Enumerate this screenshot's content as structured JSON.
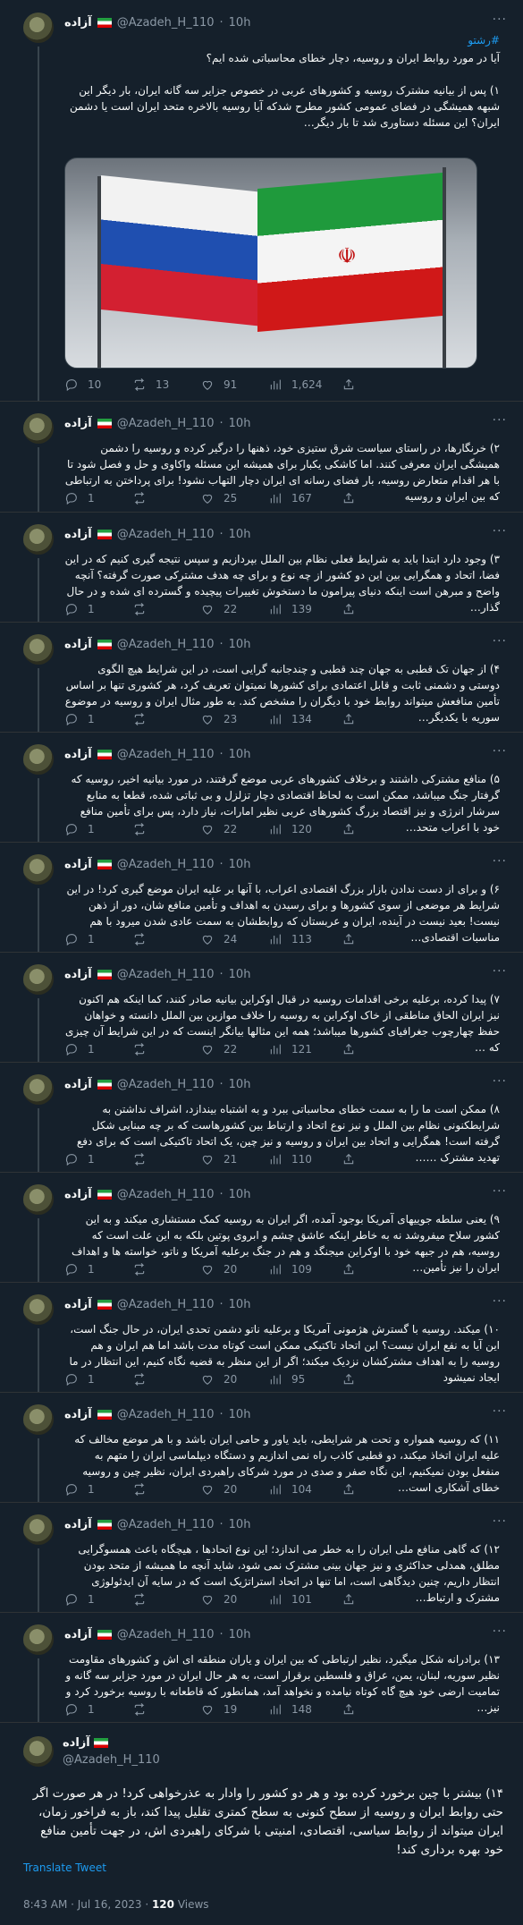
{
  "author": {
    "name": "آزاده",
    "handle": "@Azadeh_H_110",
    "handle_ltr": "@Azadeh_H_110"
  },
  "tweets": [
    {
      "time": "10h",
      "hashtag": "#رشتو",
      "text": "آیا در مورد روابط ایران و روسیه، دچار خطای محاسباتی شده ایم؟\n\n۱) پس از بیانیه مشترک روسیه و کشورهای عربی در خصوص جزایر سه گانه ایران، بار دیگر این شبهه همیشگی در فضای عمومی کشور مطرح شدکه آیا روسیه بالاخره متحد ایران است یا دشمن ایران؟ این مسئله دستاوری شد تا بار دیگر…",
      "replies": "10",
      "retweets": "13",
      "likes": "91",
      "views": "1,624"
    },
    {
      "time": "10h",
      "text": "۲) خرنگارها، در راستای سیاست شرق ستیزی خود، ذهنها را درگیر کرده و روسیه را دشمن همیشگی ایران معرفی کنند. اما کاشکی یکبار برای همیشه این مسئله واکاوی و حل و فصل شود تا با هر اقدام متعارض روسیه، بار فضای رسانه ای ایران دچار التهاب نشود! برای پرداختن به ارتباطی که بین ایران و روسیه",
      "replies": "1",
      "retweets": "",
      "likes": "25",
      "views": "167"
    },
    {
      "time": "10h",
      "text": "۳) وجود دارد ابتدا باید به شرایط فعلی نظام بین الملل بپردازیم و سپس نتیجه گیری کنیم که در این فضا، اتحاد و همگرایی بین این دو کشور از چه نوع و برای چه هدف مشترکی صورت گرفته؟ آنچه واضح و مبرهن است اینکه دنیای پیرامون ما دستخوش تغییرات پیچیده و گسترده ای شده و در حال گذار…",
      "replies": "1",
      "retweets": "",
      "likes": "22",
      "views": "139"
    },
    {
      "time": "10h",
      "text": "۴) از جهان تک قطبی به جهان چند قطبی و چندجانبه گرایی است، در این شرایط هیچ الگوی دوستی و دشمنی ثابت و قابل اعتمادی برای کشورها نمیتوان تعریف کرد، هر کشوری تنها بر اساس تأمین منافعش میتواند روابط خود با دیگران را مشخص کند. به طور مثال ایران و روسیه در موضوع سوریه با یکدیگر…",
      "replies": "1",
      "retweets": "",
      "likes": "23",
      "views": "134"
    },
    {
      "time": "10h",
      "text": "۵) منافع مشترکی داشتند و برخلاف کشورهای عربی موضع گرفتند، در مورد بیانیه اخیر، روسیه که گرفتار جنگ میباشد، ممکن است به لحاظ اقتصادی دچار تزلزل و بی ثباتی شده، قطعا به منابع سرشار انرژی و نیز اقتصاد بزرگ کشورهای عربی نظیر امارات، نیاز دارد، پس برای تأمین منافع خود با اعراب متحد…",
      "replies": "1",
      "retweets": "",
      "likes": "22",
      "views": "120"
    },
    {
      "time": "10h",
      "text": "۶) و برای از دست ندادن بازار بزرگ اقتصادی اعراب، با آنها بر علیه ایران موضع گیری کرد! در این شرایط هر موضعی از سوی کشورها و برای رسیدن به اهداف و تأمین منافع شان، دور از ذهن نیست! بعید نیست در آینده، ایران و عربستان که روابطشان به سمت عادی شدن میرود با هم مناسبات اقتصادی…",
      "replies": "1",
      "retweets": "",
      "likes": "24",
      "views": "113"
    },
    {
      "time": "10h",
      "text": "۷) پیدا کرده، برعلیه برخی اقدامات روسیه در قبال اوکراین بیانیه صادر کنند، کما اینکه هم اکنون نیز ایران الحاق مناطقی از خاک اوکراین به روسیه را خلاف موازین بین الملل دانسته و خواهان حفظ چهارچوب جغرافیای کشورها میباشد؛ همه این مثالها بیانگر اینست که در این شرایط آن چیزی که …",
      "replies": "1",
      "retweets": "",
      "likes": "22",
      "views": "121"
    },
    {
      "time": "10h",
      "text": "۸) ممکن است ما را به سمت خطای محاسباتی ببرد و به اشتباه بیندازد، اشراف نداشتن به شرایطکنونی نظام بین الملل و نیز نوع اتحاد و ارتباط بین کشورهاست که بر چه مبنایی شکل گرفته است! همگرایی و اتحاد بین ایران و روسیه و نیز چین، یک اتحاد تاکتیکی است که برای دفع تهدید مشترک ……",
      "replies": "1",
      "retweets": "",
      "likes": "21",
      "views": "110"
    },
    {
      "time": "10h",
      "text": "۹) یعنی سلطه جوییهای آمریکا بوجود آمده، اگر ایران به روسیه کمک مستشاری میکند و به این کشور سلاح میفروشد نه به خاطر اینکه عاشق چشم و ابروی پوتین بلکه به این علت است که روسیه، هم در جبهه خود با اوکراین میجنگد و هم در جنگ برعلیه آمریکا و ناتو، خواسته ها و اهداف ایران را نیز تأمین…",
      "replies": "1",
      "retweets": "",
      "likes": "20",
      "views": "109"
    },
    {
      "time": "10h",
      "text": "۱۰) میکند. روسیه با گسترش هژمونی آمریکا و برعلیه ناتو دشمن تحدی ایران، در حال جنگ است، این آیا به نفع ایران نیست؟ این اتحاد تاکتیکی ممکن است کوتاه مدت باشد اما هم ایران و هم روسیه را به اهداف مشترکشان نزدیک میکند؛ اگر از این منظر به قضیه نگاه کنیم، این انتظار در ما ایجاد نمیشود",
      "replies": "1",
      "retweets": "",
      "likes": "20",
      "views": "95"
    },
    {
      "time": "10h",
      "text": "۱۱) که روسیه همواره و تحت هر شرایطی، باید یاور و حامی ایران باشد و با هر موضع مخالف که علیه ایران اتخاذ میکند، دو قطبی کاذب راه نمی اندازیم و دستگاه دیپلماسی ایران را متهم به منفعل بودن نمیکنیم، این نگاه صفر و صدی در مورد شرکای راهبردی ایران، نظیر چین و روسیه خطای آشکاری است…",
      "replies": "1",
      "retweets": "",
      "likes": "20",
      "views": "104"
    },
    {
      "time": "10h",
      "text": "۱۲) که گاهی منافع ملی ایران را به خطر می اندازد؛ این نوع اتحادها ، هیچگاه باعث همسوگرایی مطلق، همدلی حداکثری و نیز جهان بینی مشترک نمی شود، شاید آنچه ما همیشه از متحد بودن انتظار داریم، چنین دیدگاهی است، اما تنها در اتحاد استراتژیک است که در سایه آن ایدئولوژی مشترک و ارتباط…",
      "replies": "1",
      "retweets": "",
      "likes": "20",
      "views": "101"
    },
    {
      "time": "10h",
      "text": "۱۳) برادرانه شکل میگیرد، نظیر ارتباطی که بین ایران و یاران منطقه ای اش و کشورهای مقاومت نظیر سوریه، لبنان، یمن، عراق و فلسطین برقرار است، به هر حال ایران در مورد جزایر سه گانه و تمامیت ارضی خود هیچ گاه کوتاه نیامده و نخواهد آمد، همانطور که قاطعانه با روسیه برخورد کرد و نیز…",
      "replies": "1",
      "retweets": "",
      "likes": "19",
      "views": "148"
    }
  ],
  "main_tweet": {
    "text": "۱۴) بیشتر با چین برخورد کرده بود و هر دو کشور را وادار به عذرخواهی کرد! در هر صورت اگر حتی روابط ایران و روسیه از سطح کنونی به سطح کمتری تقلیل پیدا کند، باز به فراخور زمان، ایران میتواند از روابط سیاسی، اقتصادی، امنیتی با شرکای راهبردی اش، در جهت تأمین منافع خود بهره برداری کند!",
    "translate": "Translate Tweet",
    "time": "8:43 AM · Jul 16, 2023 · ",
    "views_count": "120",
    "views_label": " Views"
  },
  "colors": {
    "background": "#15202b",
    "accent": "#1d9bf0",
    "muted": "#8b98a5",
    "divider": "#2f3336"
  },
  "icons": [
    "reply-icon",
    "retweet-icon",
    "like-icon",
    "views-icon",
    "share-icon",
    "more-icon",
    "iran-flag-icon"
  ]
}
